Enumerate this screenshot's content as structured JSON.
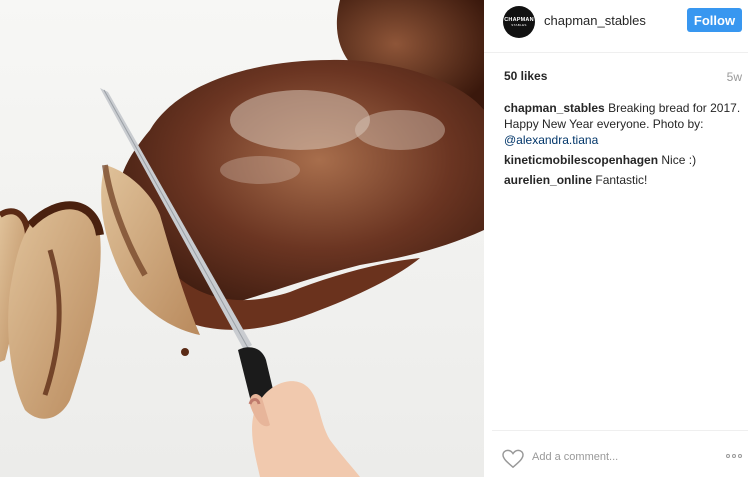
{
  "photo": {
    "description_icon": "photo"
  },
  "header": {
    "avatar_text": "CHAPMAN",
    "avatar_subtext": "STABLES",
    "username": "chapman_stables",
    "follow_label": "Follow"
  },
  "stats": {
    "likes": "50 likes",
    "age": "5w"
  },
  "comments": [
    {
      "user": "chapman_stables",
      "text": "Breaking bread for 2017. Happy New Year everyone. Photo by:",
      "mention": "@alexandra.tiana"
    },
    {
      "user": "kineticmobilescopenhagen",
      "text": "Nice :)"
    },
    {
      "user": "aurelien_online",
      "text": "Fantastic!"
    }
  ],
  "footer": {
    "add_comment_placeholder": "Add a comment...",
    "like_icon": "heart-icon",
    "more_icon": "more-options-icon"
  },
  "colors": {
    "follow_button": "#3897f0",
    "mention": "#003569",
    "text": "#262626",
    "muted": "#999999"
  }
}
